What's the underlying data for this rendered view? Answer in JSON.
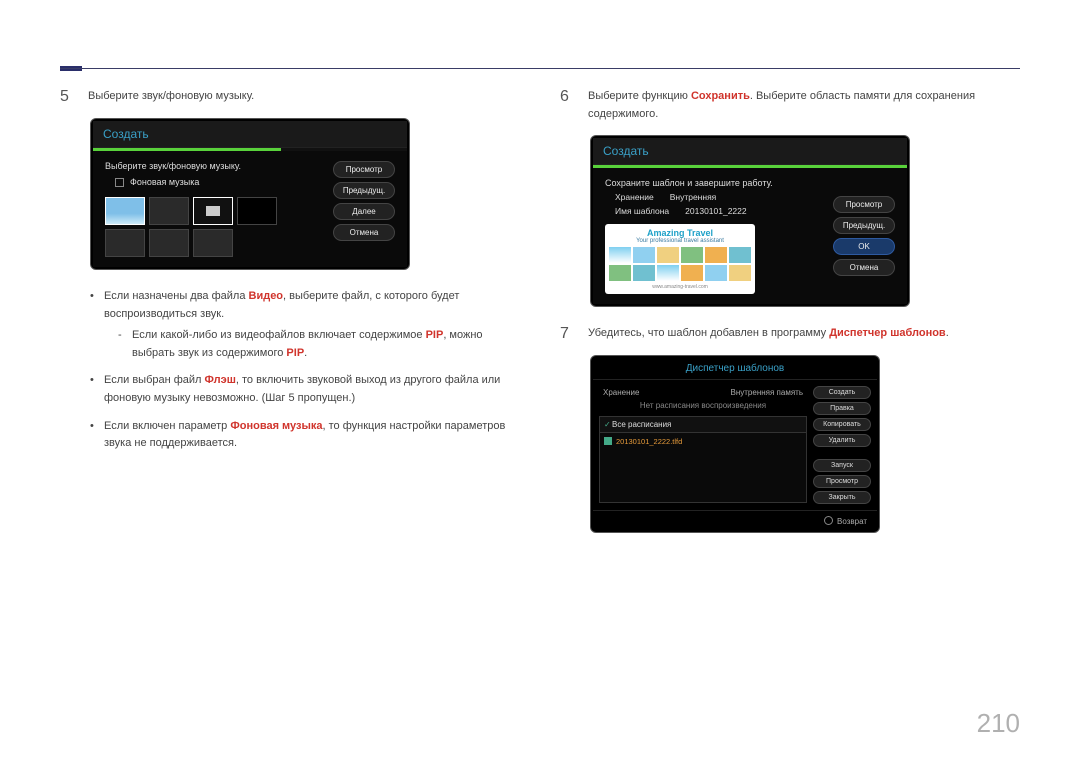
{
  "page_number": "210",
  "left": {
    "step5": {
      "num": "5",
      "text": "Выберите звук/фоновую музыку."
    },
    "screen5": {
      "title": "Создать",
      "progress_pct": 60,
      "subtitle": "Выберите звук/фоновую музыку.",
      "checkbox_label": "Фоновая музыка",
      "buttons": {
        "preview": "Просмотр",
        "prev": "Предыдущ.",
        "next": "Далее",
        "cancel": "Отмена"
      }
    },
    "notes": {
      "n1a": "Если назначены два файла ",
      "n1_red": "Видео",
      "n1b": ", выберите файл, с которого будет воспроизводиться звук.",
      "n1s_a": "Если какой-либо из видеофайлов включает содержимое ",
      "n1s_red1": "PIP",
      "n1s_b": ", можно выбрать звук из содержимого ",
      "n1s_red2": "PIP",
      "n1s_c": ".",
      "n2a": "Если выбран файл ",
      "n2_red": "Флэш",
      "n2b": ", то включить звуковой выход из другого файла или фоновую музыку невозможно. (Шаг 5 пропущен.)",
      "n3a": "Если включен параметр ",
      "n3_red": "Фоновая музыка",
      "n3b": ", то функция настройки параметров звука не поддерживается."
    }
  },
  "right": {
    "step6": {
      "num": "6",
      "text_a": "Выберите функцию ",
      "text_red": "Сохранить",
      "text_b": ". Выберите область памяти для сохранения содержимого."
    },
    "screen6": {
      "title": "Создать",
      "progress_pct": 100,
      "subtitle": "Сохраните шаблон и завершите работу.",
      "storage_label": "Хранение",
      "storage_value": "Внутренняя",
      "name_label": "Имя шаблона",
      "name_value": "20130101_2222",
      "buttons": {
        "preview": "Просмотр",
        "prev": "Предыдущ.",
        "ok": "OK",
        "cancel": "Отмена"
      },
      "card": {
        "title": "Amazing Travel",
        "sub": "Your professional travel assistant",
        "url": "www.amazing-travel.com"
      }
    },
    "step7": {
      "num": "7",
      "text_a": "Убедитесь, что шаблон добавлен в программу ",
      "text_red": "Диспетчер шаблонов",
      "text_b": "."
    },
    "screen7": {
      "title": "Диспетчер шаблонов",
      "storage_label": "Хранение",
      "storage_value": "Внутренняя память",
      "no_sched": "Нет расписания воспроизведения",
      "all_sched": "Все расписания",
      "item": "20130101_2222.tlfd",
      "side_buttons": {
        "create": "Создать",
        "edit": "Правка",
        "copy": "Копировать",
        "delete": "Удалить",
        "run": "Запуск",
        "preview": "Просмотр",
        "close": "Закрыть"
      },
      "return": "Возврат"
    }
  }
}
